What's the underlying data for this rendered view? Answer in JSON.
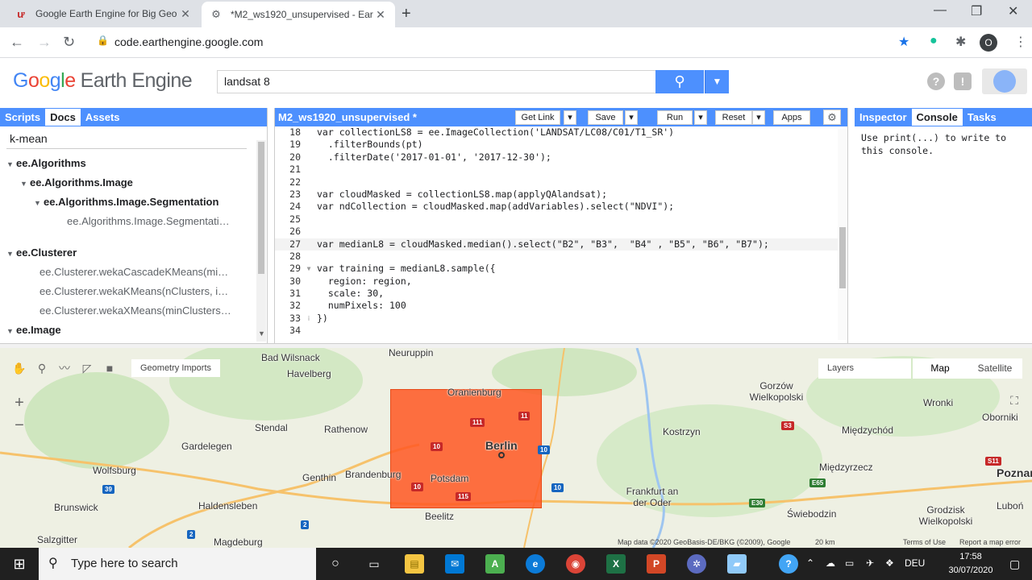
{
  "browser": {
    "tabs": [
      {
        "title": "Google Earth Engine for Big Geo",
        "active": false
      },
      {
        "title": "*M2_ws1920_unsupervised - Ear",
        "active": true
      }
    ],
    "url": "code.earthengine.google.com",
    "profile_initial": "O"
  },
  "header": {
    "logo_google": "Google",
    "logo_product": "Earth Engine",
    "search_value": "landsat 8"
  },
  "left_panel": {
    "tabs": [
      "Scripts",
      "Docs",
      "Assets"
    ],
    "active_tab": "Docs",
    "search_value": "k-mean",
    "tree": [
      {
        "label": "ee.Algorithms",
        "indent": 0,
        "bold": true,
        "arrow": "▼"
      },
      {
        "label": "ee.Algorithms.Image",
        "indent": 1,
        "bold": true,
        "arrow": "▼"
      },
      {
        "label": "ee.Algorithms.Image.Segmentation",
        "indent": 2,
        "bold": true,
        "arrow": "▼"
      },
      {
        "label": "ee.Algorithms.Image.Segmentati…",
        "indent": 3,
        "bold": false,
        "arrow": ""
      },
      {
        "label": "",
        "indent": 0,
        "bold": false,
        "arrow": ""
      },
      {
        "label": "ee.Clusterer",
        "indent": 0,
        "bold": true,
        "arrow": "▼"
      },
      {
        "label": "ee.Clusterer.wekaCascadeKMeans(mi…",
        "indent": 1,
        "bold": false,
        "arrow": ""
      },
      {
        "label": "ee.Clusterer.wekaKMeans(nClusters, i…",
        "indent": 1,
        "bold": false,
        "arrow": ""
      },
      {
        "label": "ee.Clusterer.wekaXMeans(minClusters…",
        "indent": 1,
        "bold": false,
        "arrow": ""
      },
      {
        "label": "ee.Image",
        "indent": 0,
        "bold": true,
        "arrow": "▼"
      }
    ]
  },
  "editor": {
    "title": "M2_ws1920_unsupervised *",
    "buttons": {
      "get_link": "Get Link",
      "save": "Save",
      "run": "Run",
      "reset": "Reset",
      "apps": "Apps"
    },
    "lines": [
      {
        "n": "18",
        "code": "var collectionLS8 = ee.ImageCollection('LANDSAT/LC08/C01/T1_SR')"
      },
      {
        "n": "19",
        "code": "  .filterBounds(pt)"
      },
      {
        "n": "20",
        "code": "  .filterDate('2017-01-01', '2017-12-30');"
      },
      {
        "n": "21",
        "code": ""
      },
      {
        "n": "22",
        "code": ""
      },
      {
        "n": "23",
        "code": "var cloudMasked = collectionLS8.map(applyQAlandsat);"
      },
      {
        "n": "24",
        "code": "var ndCollection = cloudMasked.map(addVariables).select(\"NDVI\");"
      },
      {
        "n": "25",
        "code": ""
      },
      {
        "n": "26",
        "code": ""
      },
      {
        "n": "27",
        "code": "var medianL8 = cloudMasked.median().select(\"B2\", \"B3\",  \"B4\" , \"B5\", \"B6\", \"B7\");"
      },
      {
        "n": "28",
        "code": ""
      },
      {
        "n": "29",
        "code": "var training = medianL8.sample({"
      },
      {
        "n": "30",
        "code": "  region: region,"
      },
      {
        "n": "31",
        "code": "  scale: 30,"
      },
      {
        "n": "32",
        "code": "  numPixels: 100"
      },
      {
        "n": "33",
        "code": "})"
      },
      {
        "n": "34",
        "code": ""
      }
    ]
  },
  "right_panel": {
    "tabs": [
      "Inspector",
      "Console",
      "Tasks"
    ],
    "active_tab": "Console",
    "console_text": "Use print(...) to write to this console."
  },
  "map": {
    "geometry_imports": "Geometry Imports",
    "layers": "Layers",
    "map_types": [
      "Map",
      "Satellite"
    ],
    "active_type": "Map",
    "zoom_in": "+",
    "zoom_out": "−",
    "towns": [
      {
        "name": "Neuruppin"
      },
      {
        "name": "Bad Wilsnack"
      },
      {
        "name": "Havelberg"
      },
      {
        "name": "Oranienburg"
      },
      {
        "name": "Gorzów Wielkopolski"
      },
      {
        "name": "Stendal"
      },
      {
        "name": "Rathenow"
      },
      {
        "name": "Berlin"
      },
      {
        "name": "Kostrzyn"
      },
      {
        "name": "Międzychód"
      },
      {
        "name": "Gardelegen"
      },
      {
        "name": "Wolfsburg"
      },
      {
        "name": "Brandenburg"
      },
      {
        "name": "Genthin"
      },
      {
        "name": "Potsdam"
      },
      {
        "name": "Międzyrzecz"
      },
      {
        "name": "Brunswick"
      },
      {
        "name": "Haldensleben"
      },
      {
        "name": "Beelitz"
      },
      {
        "name": "Frankfurt an der Oder"
      },
      {
        "name": "Świebodzin"
      },
      {
        "name": "Magdeburg"
      },
      {
        "name": "Salzgitter"
      },
      {
        "name": "Wronki"
      },
      {
        "name": "Oborniki"
      },
      {
        "name": "Grodzisk Wielkopolski"
      },
      {
        "name": "Poznań"
      },
      {
        "name": "Luboń"
      }
    ],
    "attribution": "Map data ©2020 GeoBasis-DE/BKG (©2009), Google",
    "scale": "20 km",
    "terms": "Terms of Use",
    "report": "Report a map error"
  },
  "taskbar": {
    "search_placeholder": "Type here to search",
    "language": "DEU",
    "time": "17:58",
    "date": "30/07/2020"
  }
}
